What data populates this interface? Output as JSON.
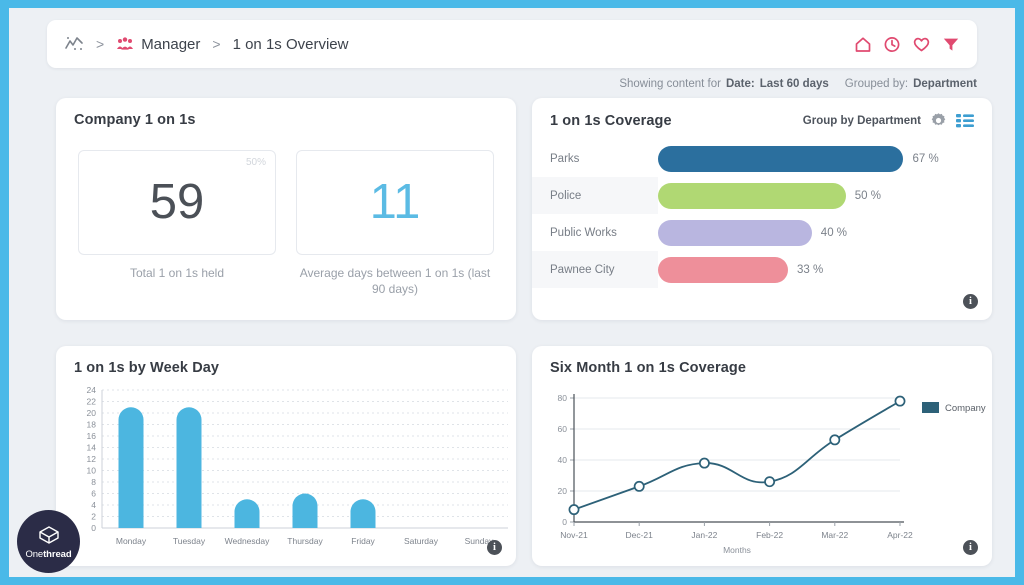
{
  "breadcrumb": {
    "analytics_icon": "analytics-trend-icon",
    "sep1": ">",
    "group_icon": "people-group-icon",
    "manager": "Manager",
    "sep2": ">",
    "current": "1 on 1s Overview"
  },
  "top_icons": [
    {
      "name": "home-icon",
      "glyph": "home"
    },
    {
      "name": "clock-icon",
      "glyph": "clock"
    },
    {
      "name": "heart-icon",
      "glyph": "heart"
    },
    {
      "name": "filter-icon",
      "glyph": "funnel"
    }
  ],
  "status": {
    "prefix": "Showing content for",
    "date_label": "Date:",
    "date_value": "Last 60 days",
    "group_label": "Grouped by:",
    "group_value": "Department"
  },
  "company_card": {
    "title": "Company 1 on 1s",
    "kpis": [
      {
        "value": "59",
        "badge": "50%",
        "caption": "Total 1 on 1s held",
        "accent": false
      },
      {
        "value": "11",
        "badge": "",
        "caption": "Average days between 1 on 1s (last 90 days)",
        "accent": true
      }
    ]
  },
  "coverage_card": {
    "title": "1 on 1s Coverage",
    "group_by": "Group by Department",
    "gear_icon": "gear-icon",
    "list_icon": "list-view-icon",
    "info_icon": "info-icon",
    "info_glyph": "i",
    "rows": [
      {
        "name": "Parks",
        "pct": 67,
        "pct_label": "67 %",
        "color": "#2b6f9e"
      },
      {
        "name": "Police",
        "pct": 50,
        "pct_label": "50 %",
        "color": "#b0d873"
      },
      {
        "name": "Public Works",
        "pct": 40,
        "pct_label": "40 %",
        "color": "#b9b6e0"
      },
      {
        "name": "Pawnee City",
        "pct": 33,
        "pct_label": "33 %",
        "color": "#ee8f9a"
      }
    ]
  },
  "weekday_card": {
    "title": "1 on 1s by Week Day",
    "info_icon": "info-icon",
    "info_glyph": "i"
  },
  "sixmonth_card": {
    "title": "Six Month 1 on 1s Coverage",
    "info_icon": "info-icon",
    "info_glyph": "i"
  },
  "watermark": {
    "pre": "One",
    "post": "thread"
  },
  "chart_data": [
    {
      "type": "bar",
      "title": "1 on 1s by Week Day",
      "categories": [
        "Monday",
        "Tuesday",
        "Wednesday",
        "Thursday",
        "Friday",
        "Saturday",
        "Sunday"
      ],
      "values": [
        21,
        21,
        5,
        6,
        5,
        0,
        0
      ],
      "yticks": [
        0,
        2,
        4,
        6,
        8,
        10,
        12,
        14,
        16,
        18,
        20,
        22,
        24
      ],
      "ylim": [
        0,
        24
      ],
      "xlabel": "",
      "ylabel": "",
      "grid": true,
      "bar_color": "#4cb6e0",
      "legend": null
    },
    {
      "type": "line",
      "title": "Six Month 1 on 1s Coverage",
      "x": [
        "Nov-21",
        "Dec-21",
        "Jan-22",
        "Feb-22",
        "Mar-22",
        "Apr-22"
      ],
      "series": [
        {
          "name": "Company",
          "values": [
            8,
            23,
            38,
            26,
            53,
            78
          ],
          "color": "#2d6178"
        }
      ],
      "yticks": [
        0,
        20,
        40,
        60,
        80
      ],
      "ylim": [
        0,
        80
      ],
      "xlabel": "Months",
      "ylabel": "",
      "grid": true,
      "legend": "right"
    }
  ]
}
